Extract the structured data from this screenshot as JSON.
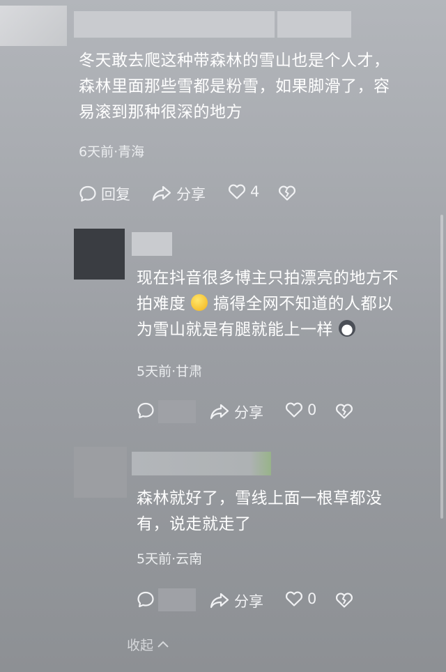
{
  "comments": [
    {
      "content_lines": [
        "冬天敢去爬这种带森林的雪山也是个人才，",
        "森林里面那些雪都是粉雪，如果脚滑了，容",
        "易滚到那种很深的地方"
      ],
      "meta": "6天前·青海",
      "reply_label": "回复",
      "share_label": "分享",
      "like_count": "4"
    },
    {
      "content_lines": [
        "现在抖音很多博主只拍漂亮的地方不",
        "拍难度",
        "搞得全网不知道的人都以",
        "为雪山就是有腿就能上一样"
      ],
      "meta": "5天前·甘肃",
      "share_label": "分享",
      "like_count": "0"
    },
    {
      "content_lines": [
        "森林就好了，雪线上面一根草都没",
        "有，说走就走了"
      ],
      "meta": "5天前·云南",
      "share_label": "分享",
      "like_count": "0"
    }
  ],
  "collapse_label": "收起",
  "icons": {
    "reply": "speech-bubble-icon",
    "share": "share-arrow-icon",
    "like": "heart-icon",
    "dislike": "broken-heart-icon",
    "collapse": "chevron-up-icon"
  }
}
